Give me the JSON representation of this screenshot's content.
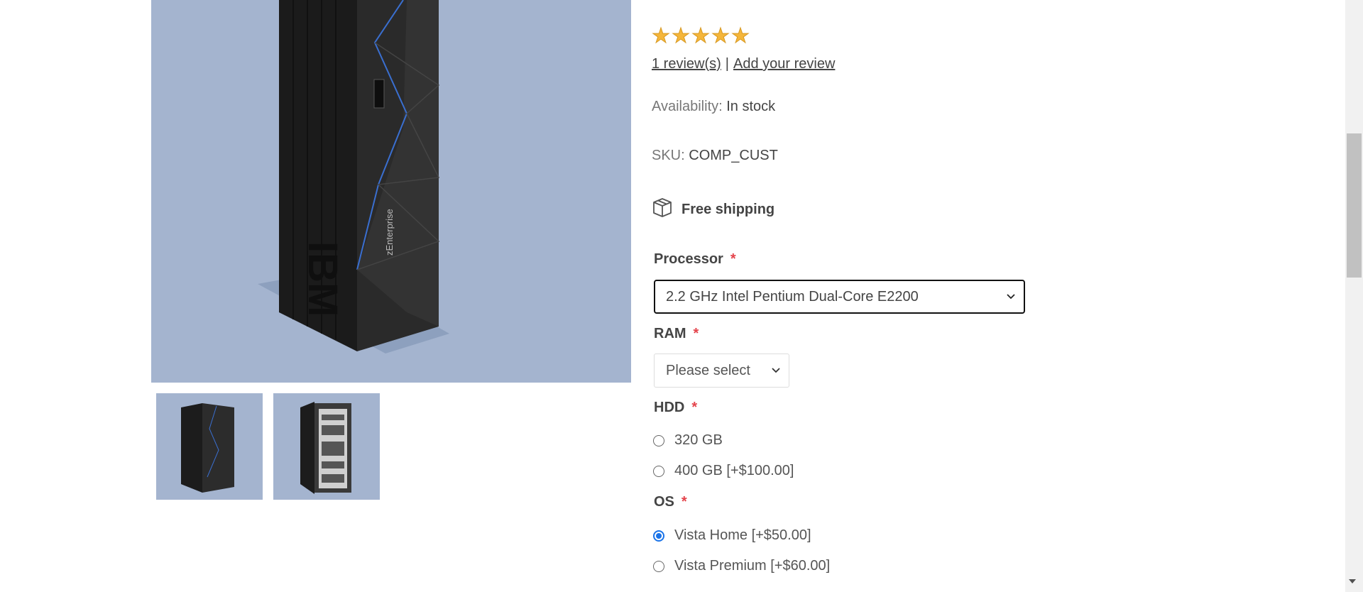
{
  "product": {
    "image_alt": "IBM zEnterprise mainframe",
    "thumbnails": [
      "thumbnail-front",
      "thumbnail-open"
    ]
  },
  "rating": {
    "stars": 5,
    "filled": 5
  },
  "reviews": {
    "count_link": "1 review(s)",
    "separator": "|",
    "add_link": "Add your review"
  },
  "availability": {
    "label": "Availability:",
    "value": "In stock"
  },
  "sku": {
    "label": "SKU:",
    "value": "COMP_CUST"
  },
  "shipping": {
    "icon": "package-icon",
    "label": "Free shipping"
  },
  "attributes": {
    "processor": {
      "label": "Processor",
      "required": "*",
      "selected": "2.2 GHz Intel Pentium Dual-Core E2200"
    },
    "ram": {
      "label": "RAM",
      "required": "*",
      "selected": "Please select"
    },
    "hdd": {
      "label": "HDD",
      "required": "*",
      "options": [
        {
          "label": "320 GB",
          "checked": false
        },
        {
          "label": "400 GB [+$100.00]",
          "checked": false
        }
      ]
    },
    "os": {
      "label": "OS",
      "required": "*",
      "options": [
        {
          "label": "Vista Home [+$50.00]",
          "checked": true
        },
        {
          "label": "Vista Premium [+$60.00]",
          "checked": false
        }
      ]
    }
  },
  "colors": {
    "image_bg": "#a4b4cf",
    "star": "#f5b63a",
    "required": "#e4434b",
    "radio_checked": "#1a73e8"
  }
}
